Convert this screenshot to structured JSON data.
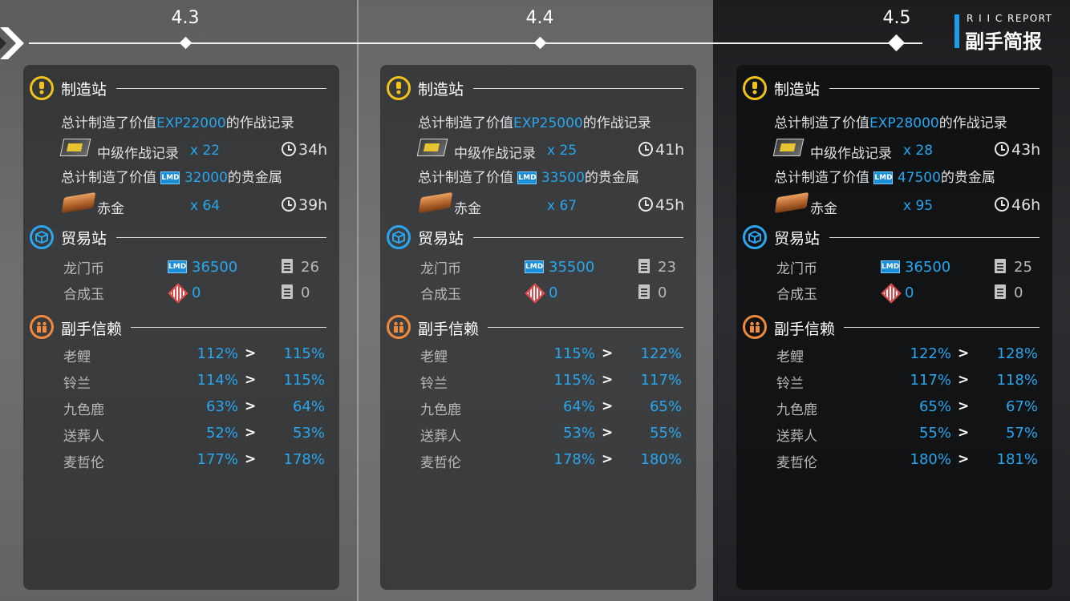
{
  "header": {
    "title_en": "R I I C REPORT",
    "title_cn": "副手简报"
  },
  "dates": [
    "4.3",
    "4.4",
    "4.5"
  ],
  "labels": {
    "factory": "制造站",
    "trade": "贸易站",
    "trust": "副手信赖",
    "record_name": "中级作战记录",
    "gold_name": "赤金",
    "lmd": "龙门币",
    "orundum": "合成玉"
  },
  "panels": [
    {
      "exp_line": [
        "总计制造了价值",
        "EXP22000",
        "的作战记录"
      ],
      "record_count": "x 22",
      "record_time": "34h",
      "gold_line": [
        "总计制造了价值",
        "32000",
        "的贵金属"
      ],
      "gold_count": "x 64",
      "gold_time": "39h",
      "lmd_value": "36500",
      "lmd_orders": "26",
      "orundum_value": "0",
      "orundum_orders": "0",
      "trust": [
        {
          "name": "老鲤",
          "from": "112%",
          "to": "115%"
        },
        {
          "name": "铃兰",
          "from": "114%",
          "to": "115%"
        },
        {
          "name": "九色鹿",
          "from": "63%",
          "to": "64%"
        },
        {
          "name": "送葬人",
          "from": "52%",
          "to": "53%"
        },
        {
          "name": "麦哲伦",
          "from": "177%",
          "to": "178%"
        }
      ]
    },
    {
      "exp_line": [
        "总计制造了价值",
        "EXP25000",
        "的作战记录"
      ],
      "record_count": "x 25",
      "record_time": "41h",
      "gold_line": [
        "总计制造了价值",
        "33500",
        "的贵金属"
      ],
      "gold_count": "x 67",
      "gold_time": "45h",
      "lmd_value": "35500",
      "lmd_orders": "23",
      "orundum_value": "0",
      "orundum_orders": "0",
      "trust": [
        {
          "name": "老鲤",
          "from": "115%",
          "to": "122%"
        },
        {
          "name": "铃兰",
          "from": "115%",
          "to": "117%"
        },
        {
          "name": "九色鹿",
          "from": "64%",
          "to": "65%"
        },
        {
          "name": "送葬人",
          "from": "53%",
          "to": "55%"
        },
        {
          "name": "麦哲伦",
          "from": "178%",
          "to": "180%"
        }
      ]
    },
    {
      "exp_line": [
        "总计制造了价值",
        "EXP28000",
        "的作战记录"
      ],
      "record_count": "x 28",
      "record_time": "43h",
      "gold_line": [
        "总计制造了价值",
        "47500",
        "的贵金属"
      ],
      "gold_count": "x 95",
      "gold_time": "46h",
      "lmd_value": "36500",
      "lmd_orders": "25",
      "orundum_value": "0",
      "orundum_orders": "0",
      "trust": [
        {
          "name": "老鲤",
          "from": "122%",
          "to": "128%"
        },
        {
          "name": "铃兰",
          "from": "117%",
          "to": "118%"
        },
        {
          "name": "九色鹿",
          "from": "65%",
          "to": "67%"
        },
        {
          "name": "送葬人",
          "from": "55%",
          "to": "57%"
        },
        {
          "name": "麦哲伦",
          "from": "180%",
          "to": "181%"
        }
      ]
    }
  ],
  "arrow_glyph": ">",
  "lmd_icon_text": "LMD",
  "colors": {
    "accent_blue": "#28a6ee",
    "factory_yellow": "#f2c21a",
    "trade_blue": "#2ba6f0",
    "trust_orange": "#f08a3c"
  },
  "icons": {
    "back": "back-chevron-icon",
    "factory": "factory-icon",
    "trade": "trade-icon",
    "trust": "trust-icon",
    "clock": "clock-icon",
    "order": "order-doc-icon",
    "record": "battle-record-icon",
    "gold": "pure-gold-icon",
    "lmd": "lmd-icon",
    "orundum": "orundum-icon"
  }
}
